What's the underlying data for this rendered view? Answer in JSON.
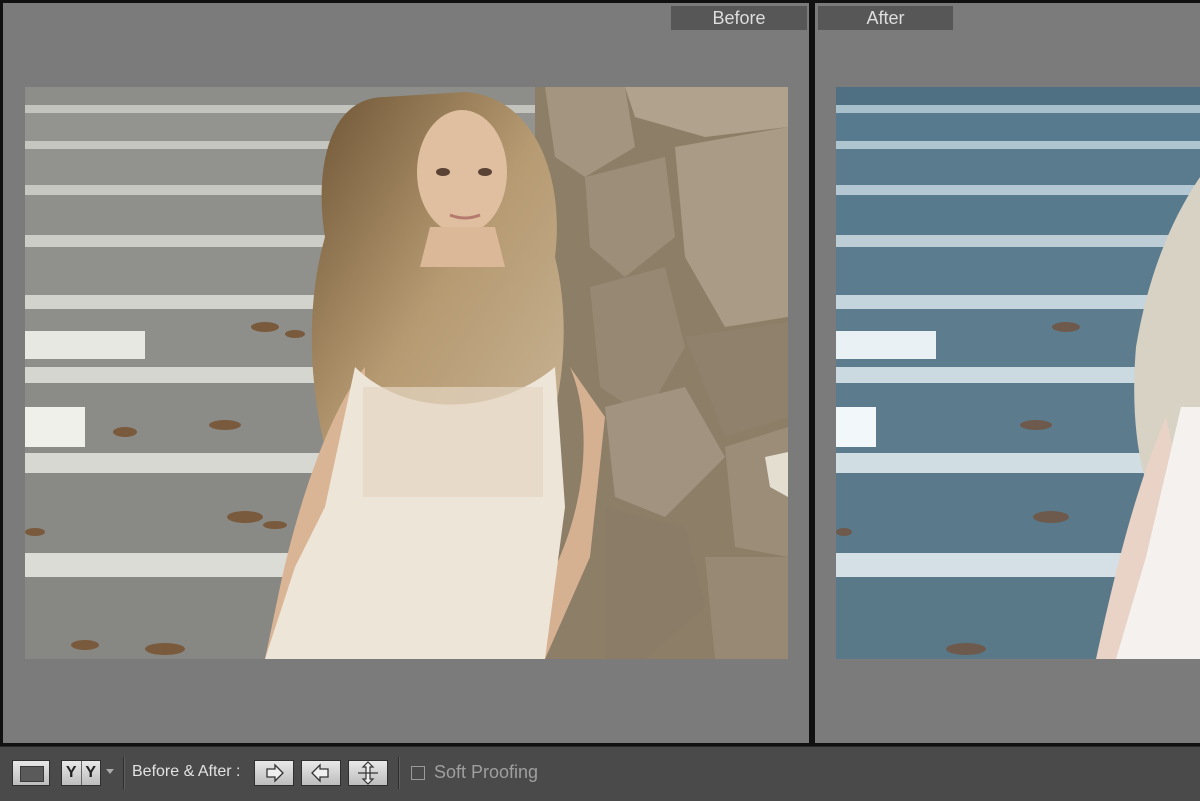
{
  "panes": {
    "before_label": "Before",
    "after_label": "After"
  },
  "toolbar": {
    "loupe_icon": "loupe-view-icon",
    "yy_left": "Y",
    "yy_right": "Y",
    "before_after_label": "Before & After :",
    "copy_before_to_after_icon": "arrow-right-icon",
    "copy_after_to_before_icon": "arrow-left-icon",
    "swap_icon": "swap-arrows-icon",
    "soft_proofing_label": "Soft Proofing",
    "soft_proofing_checked": false
  },
  "colors": {
    "pane_bg": "#7b7b7b",
    "label_bg": "#575757",
    "toolbar_bg": "#4a4a4a"
  }
}
